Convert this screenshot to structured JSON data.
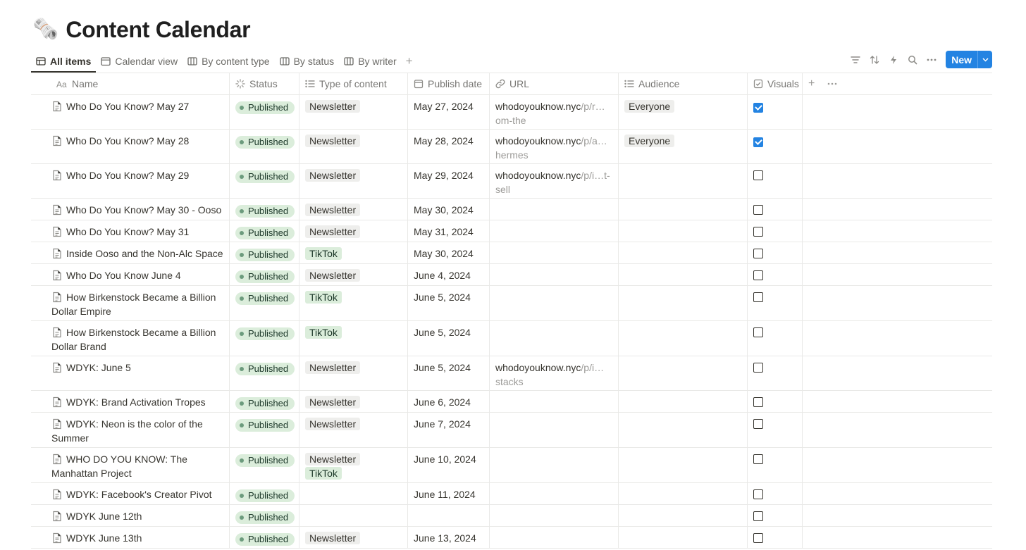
{
  "page": {
    "emoji": "🗞️",
    "title": "Content Calendar"
  },
  "tabs": [
    {
      "label": "All items",
      "icon": "table-icon",
      "active": true
    },
    {
      "label": "Calendar view",
      "icon": "calendar-icon",
      "active": false
    },
    {
      "label": "By content type",
      "icon": "board-icon",
      "active": false
    },
    {
      "label": "By status",
      "icon": "board-icon",
      "active": false
    },
    {
      "label": "By writer",
      "icon": "board-icon",
      "active": false
    }
  ],
  "toolbar": {
    "new_label": "New",
    "icons": [
      "filter-icon",
      "sort-icon",
      "automation-icon",
      "search-icon",
      "more-icon"
    ]
  },
  "columns": {
    "name": "Name",
    "status": "Status",
    "type": "Type of content",
    "date": "Publish date",
    "url": "URL",
    "audience": "Audience",
    "visuals": "Visuals"
  },
  "colors": {
    "accent": "#2383e2",
    "status_bg": "#dbeddb",
    "tiktok_bg": "#dbeddb",
    "tag_bg": "#eeeeec"
  },
  "rows": [
    {
      "name": "Who Do You Know? May 27",
      "status": "Published",
      "types": [
        "Newsletter"
      ],
      "date": "May 27, 2024",
      "url_main": "whodoyouknow.nyc",
      "url_dim": "/p/r…",
      "url_cont": "om-the",
      "audience": "Everyone",
      "visuals": true,
      "h": 48
    },
    {
      "name": "Who Do You Know? May 28",
      "status": "Published",
      "types": [
        "Newsletter"
      ],
      "date": "May 28, 2024",
      "url_main": "whodoyouknow.nyc",
      "url_dim": "/p/a…",
      "url_cont": "hermes",
      "audience": "Everyone",
      "visuals": true,
      "h": 48
    },
    {
      "name": "Who Do You Know? May 29",
      "status": "Published",
      "types": [
        "Newsletter"
      ],
      "date": "May 29, 2024",
      "url_main": "whodoyouknow.nyc",
      "url_dim": "/p/i…t-",
      "url_cont": "sell",
      "audience": "",
      "visuals": false,
      "h": 48
    },
    {
      "name": "Who Do You Know? May 30 - Ooso",
      "status": "Published",
      "types": [
        "Newsletter"
      ],
      "date": "May 30, 2024",
      "url_main": "",
      "url_dim": "",
      "url_cont": "",
      "audience": "",
      "visuals": false,
      "h": 30
    },
    {
      "name": "Who Do You Know? May 31",
      "status": "Published",
      "types": [
        "Newsletter"
      ],
      "date": "May 31, 2024",
      "url_main": "",
      "url_dim": "",
      "url_cont": "",
      "audience": "",
      "visuals": false,
      "h": 30
    },
    {
      "name": "Inside Ooso and the Non-Alc Space",
      "status": "Published",
      "types": [
        "TikTok"
      ],
      "date": "May 30, 2024",
      "url_main": "",
      "url_dim": "",
      "url_cont": "",
      "audience": "",
      "visuals": false,
      "h": 30
    },
    {
      "name": "Who Do You Know June 4",
      "status": "Published",
      "types": [
        "Newsletter"
      ],
      "date": "June 4, 2024",
      "url_main": "",
      "url_dim": "",
      "url_cont": "",
      "audience": "",
      "visuals": false,
      "h": 30
    },
    {
      "name": "How Birkenstock Became a Billion Dollar Empire",
      "status": "Published",
      "types": [
        "TikTok"
      ],
      "date": "June 5, 2024",
      "url_main": "",
      "url_dim": "",
      "url_cont": "",
      "audience": "",
      "visuals": false,
      "h": 49
    },
    {
      "name": "How Birkenstock Became a Billion Dollar Brand",
      "status": "Published",
      "types": [
        "TikTok"
      ],
      "date": "June 5, 2024",
      "url_main": "",
      "url_dim": "",
      "url_cont": "",
      "audience": "",
      "visuals": false,
      "h": 49
    },
    {
      "name": "WDYK: June 5",
      "status": "Published",
      "types": [
        "Newsletter"
      ],
      "date": "June 5, 2024",
      "url_main": "whodoyouknow.nyc",
      "url_dim": "/p/i…",
      "url_cont": "stacks",
      "audience": "",
      "visuals": false,
      "h": 48
    },
    {
      "name": "WDYK: Brand Activation Tropes",
      "status": "Published",
      "types": [
        "Newsletter"
      ],
      "date": "June 6, 2024",
      "url_main": "",
      "url_dim": "",
      "url_cont": "",
      "audience": "",
      "visuals": false,
      "h": 30
    },
    {
      "name": "WDYK: Neon is the color of the Summer",
      "status": "Published",
      "types": [
        "Newsletter"
      ],
      "date": "June 7, 2024",
      "url_main": "",
      "url_dim": "",
      "url_cont": "",
      "audience": "",
      "visuals": false,
      "h": 49
    },
    {
      "name": "WHO DO YOU KNOW: The Manhattan Project",
      "status": "Published",
      "types": [
        "Newsletter",
        "TikTok"
      ],
      "date": "June 10, 2024",
      "url_main": "",
      "url_dim": "",
      "url_cont": "",
      "audience": "",
      "visuals": false,
      "h": 49
    },
    {
      "name": "WDYK: Facebook's Creator Pivot",
      "status": "Published",
      "types": [],
      "date": "June 11, 2024",
      "url_main": "",
      "url_dim": "",
      "url_cont": "",
      "audience": "",
      "visuals": false,
      "h": 30
    },
    {
      "name": "WDYK June 12th",
      "status": "Published",
      "types": [],
      "date": "",
      "url_main": "",
      "url_dim": "",
      "url_cont": "",
      "audience": "",
      "visuals": false,
      "h": 30
    },
    {
      "name": "WDYK June 13th",
      "status": "Published",
      "types": [
        "Newsletter"
      ],
      "date": "June 13, 2024",
      "url_main": "",
      "url_dim": "",
      "url_cont": "",
      "audience": "",
      "visuals": false,
      "h": 30
    }
  ]
}
